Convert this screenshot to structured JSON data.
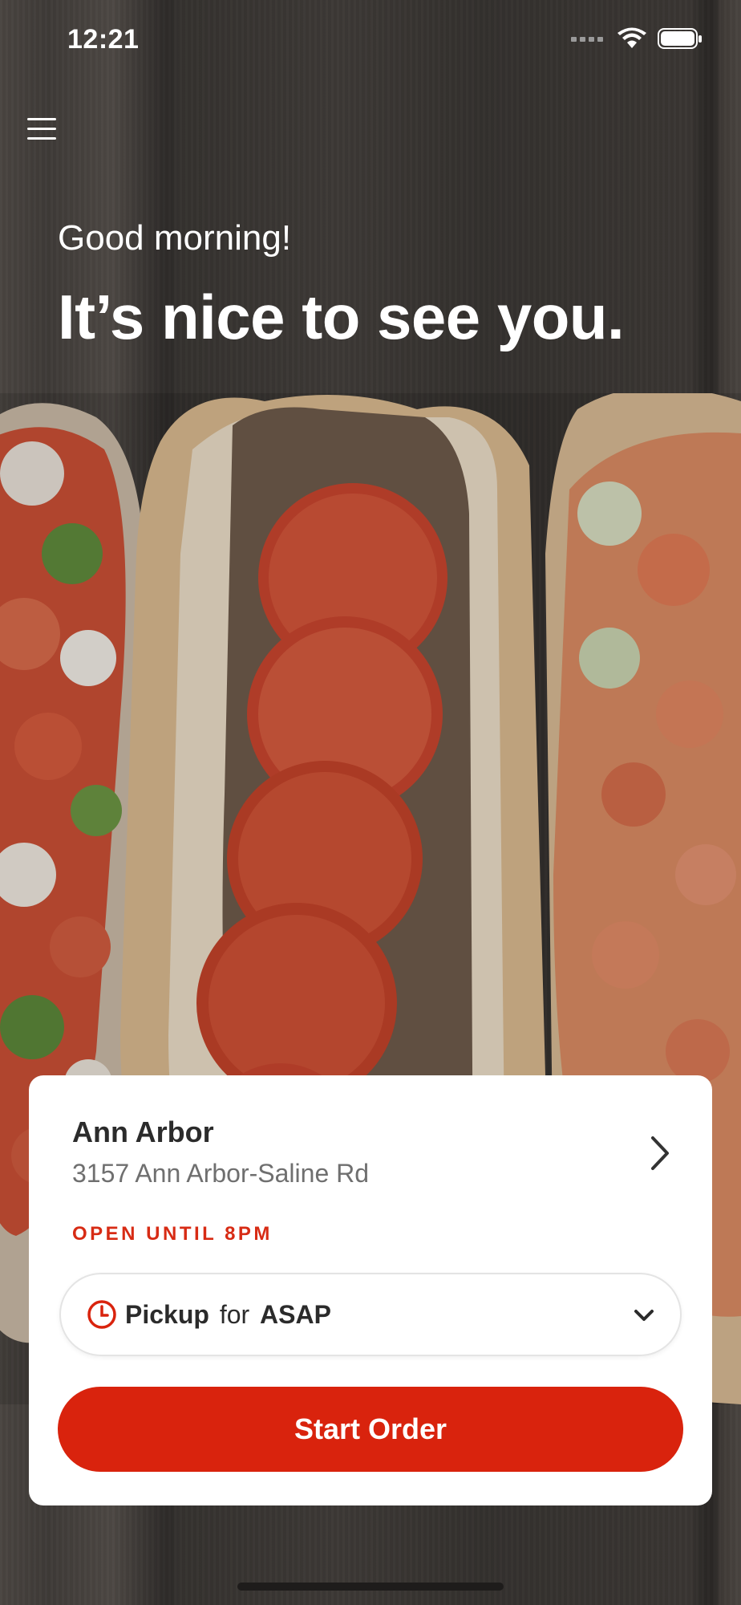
{
  "status_bar": {
    "time": "12:21"
  },
  "hero": {
    "greeting": "Good morning!",
    "headline": "It’s nice to see you."
  },
  "location": {
    "name": "Ann Arbor",
    "address": "3157 Ann Arbor-Saline Rd",
    "status": "OPEN UNTIL 8PM"
  },
  "order_mode": {
    "mode": "Pickup",
    "connector": "for",
    "time": "ASAP"
  },
  "actions": {
    "start_order_label": "Start Order"
  },
  "colors": {
    "accent": "#d9230d",
    "status_text": "#d72b14"
  },
  "icons": {
    "menu": "hamburger-menu-icon",
    "chevron": "chevron-right-icon",
    "clock": "clock-icon",
    "caret": "chevron-down-icon"
  }
}
